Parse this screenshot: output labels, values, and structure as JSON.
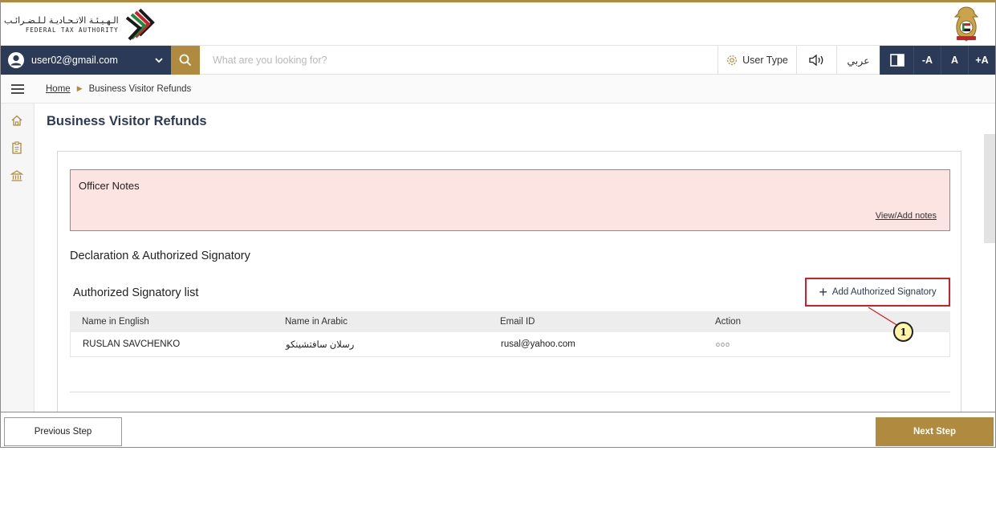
{
  "header": {
    "logo_arabic": "الـهـيـئـة الاتـحـاديـة لـلـضـرائـب",
    "logo_english": "FEDERAL TAX AUTHORITY"
  },
  "toolbar": {
    "user_email": "user02@gmail.com",
    "search_placeholder": "What are you looking for?",
    "user_type_label": "User Type",
    "arabic_label": "عربي",
    "font_decrease": "-A",
    "font_normal": "A",
    "font_increase": "+A"
  },
  "breadcrumb": {
    "home": "Home",
    "current": "Business Visitor Refunds"
  },
  "page": {
    "title": "Business Visitor Refunds"
  },
  "officer_notes": {
    "title": "Officer Notes",
    "link": "View/Add notes"
  },
  "declaration": {
    "heading": "Declaration & Authorized Signatory",
    "list_title": "Authorized Signatory list",
    "add_button": "Add Authorized Signatory",
    "columns": [
      "Name in English",
      "Name in Arabic",
      "Email ID",
      "Action"
    ],
    "rows": [
      {
        "name_en": "RUSLAN SAVCHENKO",
        "name_ar": "رسلان سافتشينكو",
        "email": "rusal@yahoo.com",
        "action": "ooo"
      }
    ]
  },
  "callout": {
    "number": "1"
  },
  "footer": {
    "previous": "Previous Step",
    "next": "Next Step"
  },
  "colors": {
    "navy": "#2b3a56",
    "gold": "#b08a3e",
    "notes_bg": "#fbe4e1",
    "notes_border": "#e06a6a",
    "highlight_red": "#d21f27",
    "callout_fill": "#fff4a8"
  },
  "icons": [
    "user-avatar-icon",
    "chevron-down-icon",
    "search-icon",
    "gear-icon",
    "speaker-icon",
    "contrast-icon",
    "hamburger-icon",
    "home-icon",
    "clipboard-icon",
    "bank-icon",
    "plus-icon"
  ]
}
